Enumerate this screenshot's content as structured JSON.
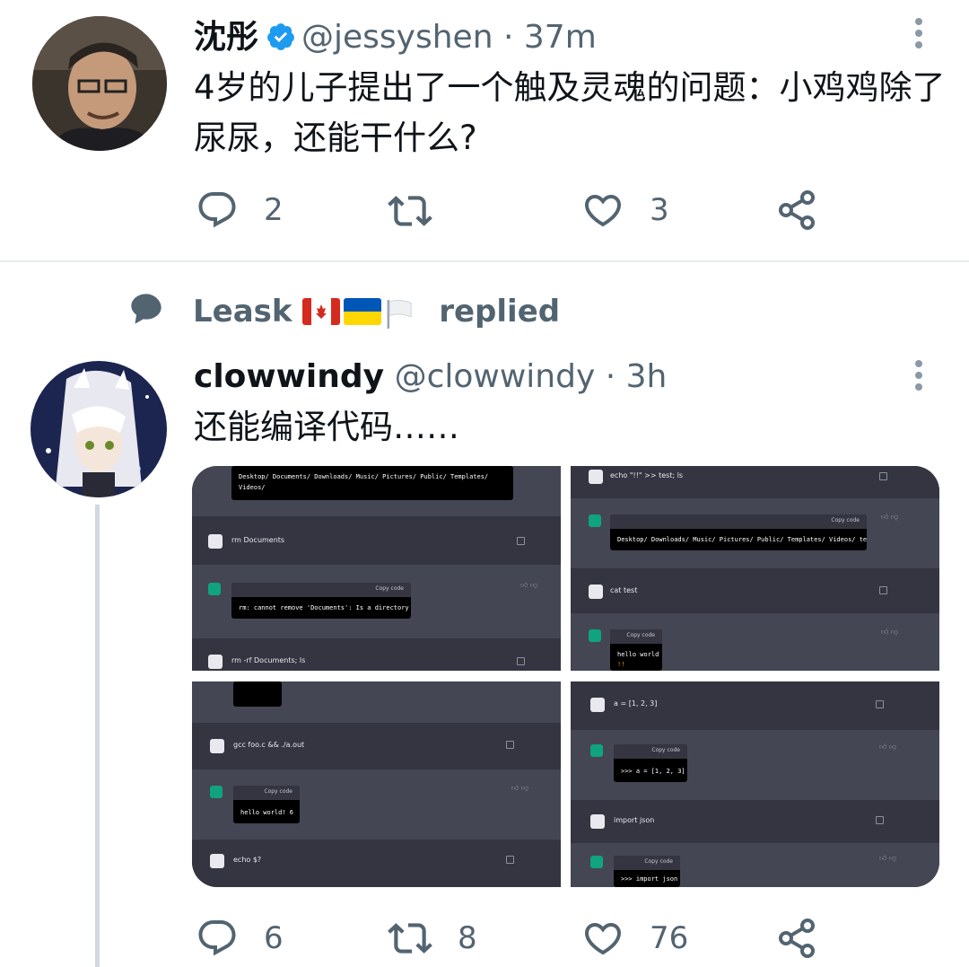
{
  "tweet1": {
    "name": "沈彤",
    "handle": "@jessyshen",
    "sep": "·",
    "time": "37m",
    "text": "4岁的儿子提出了一个触及灵魂的问题：小鸡鸡除了尿尿，还能干什么?",
    "reply_count": "2",
    "retweet_count": "",
    "like_count": "3"
  },
  "reply_context": {
    "user": "Leask",
    "label": "replied"
  },
  "tweet2": {
    "name": "clowwindy",
    "handle": "@clowwindy",
    "sep": "·",
    "time": "3h",
    "text": "还能编译代码……",
    "reply_count": "6",
    "retweet_count": "8",
    "like_count": "76"
  },
  "media": {
    "tile1": {
      "top_code": "Desktop/ Documents/ Downloads/ Music/ Pictures/ Public/ Templates/ Videos/",
      "cmd1": "rm Documents",
      "copy": "Copy code",
      "out1": "rm: cannot remove 'Documents': Is a directory",
      "cmd2": "rm -rf Documents; ls"
    },
    "tile2": {
      "cmd1": "echo \"!!\" >> test; ls",
      "copy": "Copy code",
      "out1": "Desktop/ Downloads/ Music/ Pictures/ Public/ Templates/ Videos/ test",
      "cmd2": "cat test",
      "out2a": "hello world",
      "out2b": "!!"
    },
    "tile3": {
      "cmd1": "gcc foo.c && ./a.out",
      "copy": "Copy code",
      "out1": "hello world! 6",
      "cmd2": "echo $?"
    },
    "tile4": {
      "cmd1": "a = [1, 2, 3]",
      "copy": "Copy code",
      "out1": ">>> a = [1, 2, 3]",
      "cmd2": "import json",
      "out2": ">>> import json"
    }
  },
  "colors": {
    "verified": "#1d9bf0",
    "muted": "#536471",
    "chatgpt_green": "#10a37f"
  }
}
